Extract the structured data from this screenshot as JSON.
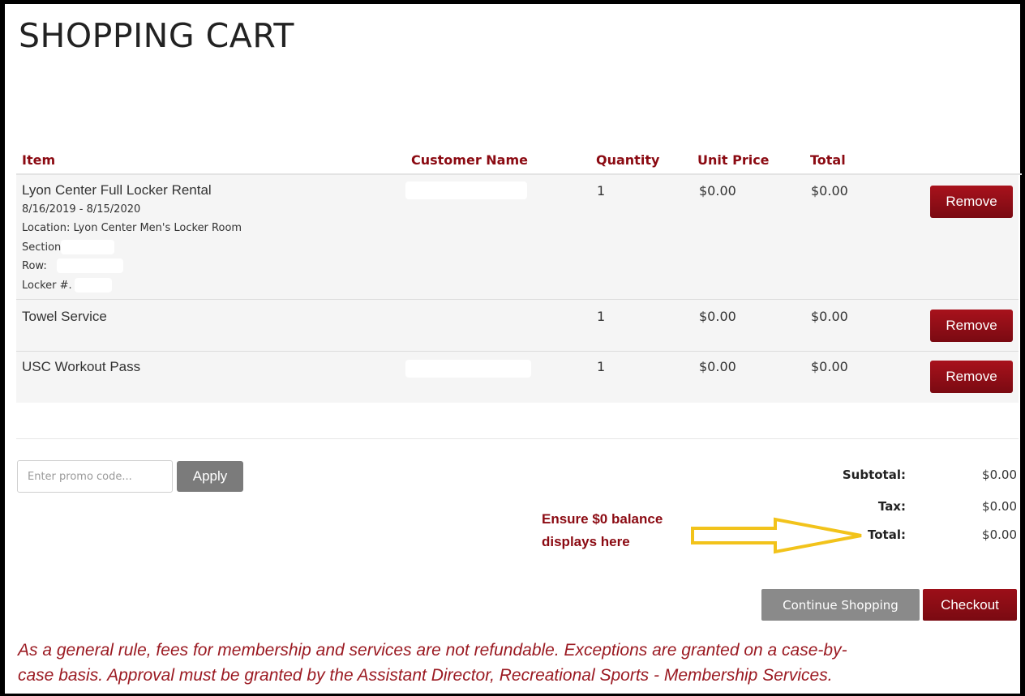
{
  "page": {
    "title": "SHOPPING CART"
  },
  "table": {
    "headers": {
      "item": "Item",
      "customer": "Customer Name",
      "quantity": "Quantity",
      "unit_price": "Unit Price",
      "total": "Total"
    },
    "rows": [
      {
        "name": "Lyon Center Full Locker Rental",
        "details": [
          "8/16/2019 - 8/15/2020",
          "Location: Lyon Center Men's Locker Room",
          "Section: .",
          "Row:",
          "Locker #."
        ],
        "quantity": "1",
        "unit_price": "$0.00",
        "total": "$0.00",
        "remove_label": "Remove"
      },
      {
        "name": "Towel Service",
        "details": [],
        "quantity": "1",
        "unit_price": "$0.00",
        "total": "$0.00",
        "remove_label": "Remove"
      },
      {
        "name": "USC Workout Pass",
        "details": [],
        "quantity": "1",
        "unit_price": "$0.00",
        "total": "$0.00",
        "remove_label": "Remove"
      }
    ]
  },
  "promo": {
    "placeholder": "Enter promo code...",
    "apply_label": "Apply"
  },
  "summary": {
    "subtotal_label": "Subtotal:",
    "subtotal": "$0.00",
    "tax_label": "Tax:",
    "tax": "$0.00",
    "total_label": "Total:",
    "total": "$0.00"
  },
  "annotation": {
    "line1": "Ensure $0 balance",
    "line2": "displays here",
    "arrow_color": "#f2c31b",
    "text_color": "#8b0a12"
  },
  "actions": {
    "continue_label": "Continue Shopping",
    "checkout_label": "Checkout"
  },
  "policy": {
    "line1": "As a general rule, fees for membership and services are not refundable.  Exceptions are granted on a case-by-",
    "line2": "case basis.  Approval must be granted by the Assistant Director, Recreational Sports - Membership Services."
  },
  "colors": {
    "accent": "#8b0a12",
    "button_gray": "#7b7b7b",
    "row_bg": "#f5f5f5"
  }
}
